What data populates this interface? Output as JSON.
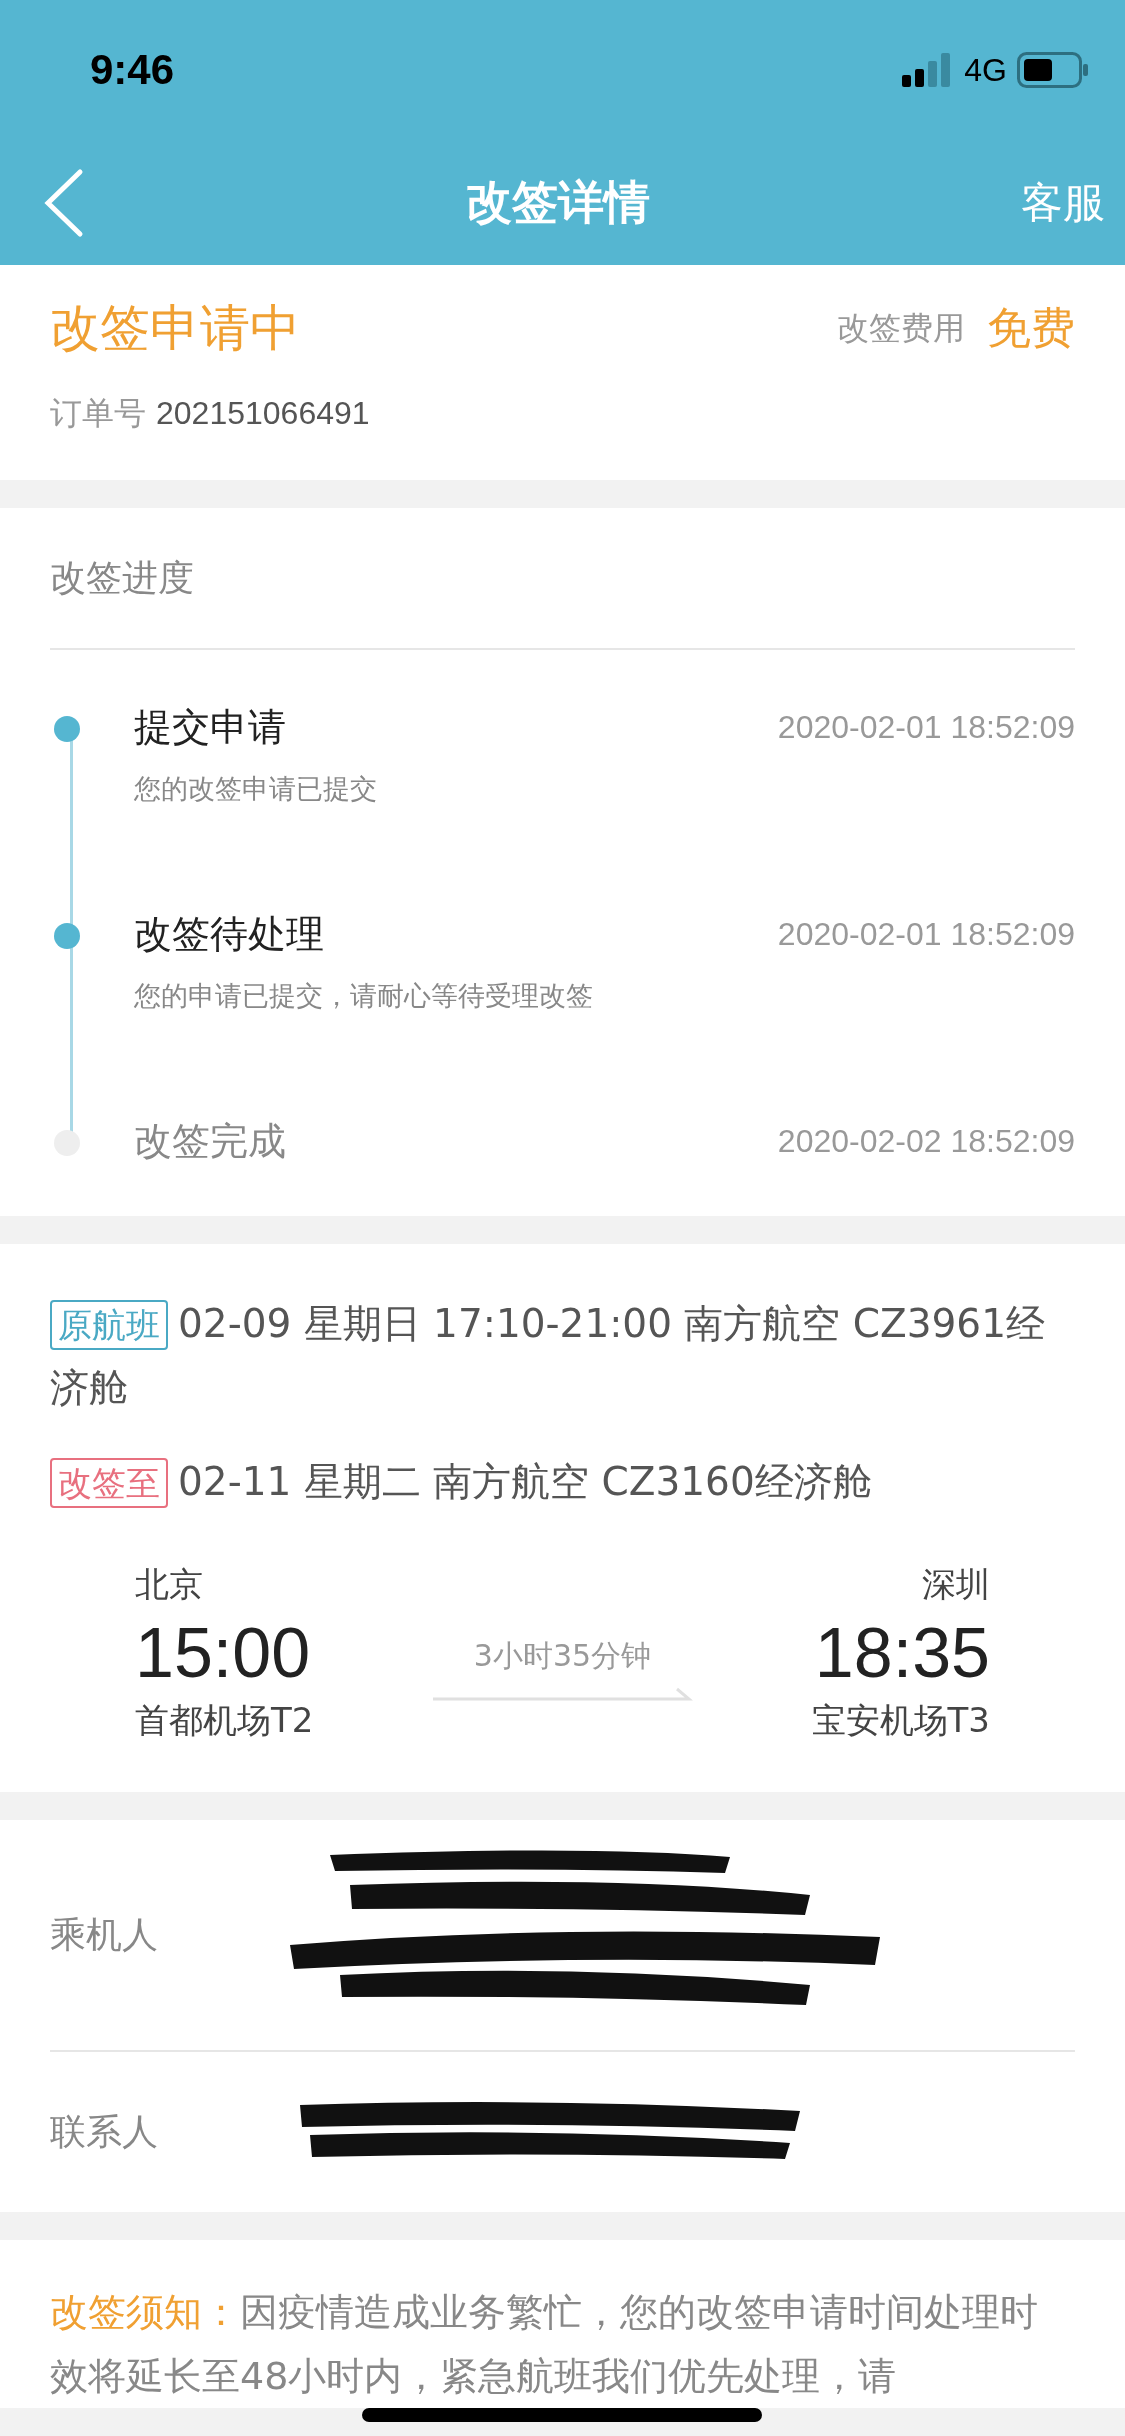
{
  "status_bar": {
    "time": "9:46",
    "network": "4G"
  },
  "nav": {
    "title": "改签详情",
    "right": "客服"
  },
  "summary": {
    "status": "改签申请中",
    "fee_label": "改签费用",
    "fee": "免费",
    "order_label": "订单号",
    "order_no": "202151066491"
  },
  "progress": {
    "title": "改签进度",
    "steps": [
      {
        "title": "提交申请",
        "desc": "您的改签申请已提交",
        "time": "2020-02-01 18:52:09",
        "done": true
      },
      {
        "title": "改签待处理",
        "desc": "您的申请已提交，请耐心等待受理改签",
        "time": "2020-02-01 18:52:09",
        "done": true
      },
      {
        "title": "改签完成",
        "time": "2020-02-02 18:52:09",
        "done": false
      }
    ]
  },
  "flights": [
    {
      "tag": "原航班",
      "color": "#4aa9c4",
      "lines": [
        "02-09 星期日 17:10-21:00 南方航空 CZ3961经",
        "济舱"
      ]
    },
    {
      "tag": "改签至",
      "color": "#e8707f",
      "lines": [
        "02-11 星期二 南方航空 CZ3160经济舱"
      ]
    }
  ],
  "route": {
    "from_city": "北京",
    "from_time": "15:00",
    "from_airport": "首都机场T2",
    "duration": "3小时35分钟",
    "to_city": "深圳",
    "to_time": "18:35",
    "to_airport": "宝安机场T3"
  },
  "people": [
    {
      "label": "乘机人",
      "kind": "redacted"
    },
    {
      "label": "联系人",
      "kind": "redacted"
    }
  ],
  "notice": {
    "label": "改签须知：",
    "text": "因疫情造成业务繁忙，您的改签申请时间处理时效将延长至48小时内，紧急航班我们优先处理，请"
  }
}
